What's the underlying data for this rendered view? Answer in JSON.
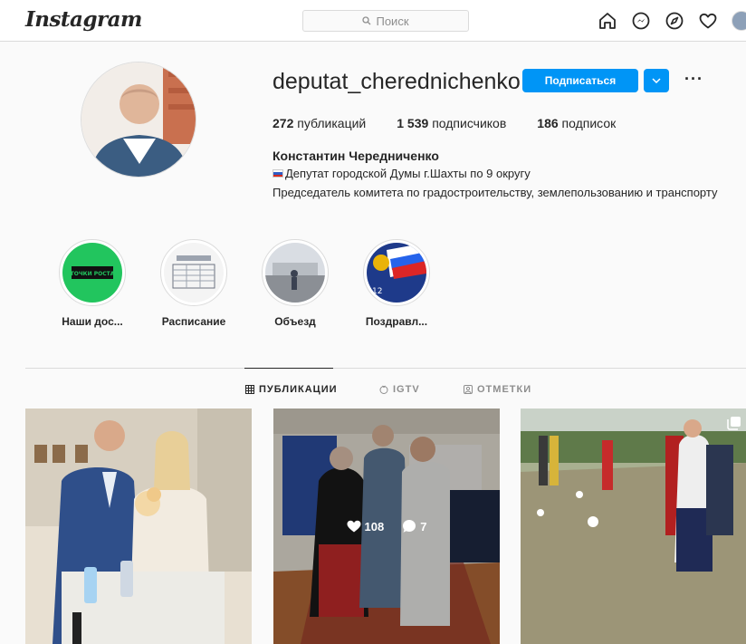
{
  "header": {
    "logo": "Instagram",
    "search_placeholder": "Поиск"
  },
  "profile": {
    "username": "deputat_cherednichenko",
    "follow_label": "Подписаться",
    "stats": [
      {
        "count": "272",
        "label": "публикаций"
      },
      {
        "count": "1 539",
        "label": "подписчиков"
      },
      {
        "count": "186",
        "label": "подписок"
      }
    ],
    "full_name": "Константин Чередниченко",
    "bio_line1": "Депутат городской Думы г.Шахты по 9 округу",
    "bio_line2": "Председатель комитета по градостроительству, землепользованию и транспорту"
  },
  "highlights": [
    {
      "label": "Наши дос...",
      "image_text": "ТОЧКИ РОСТА"
    },
    {
      "label": "Расписание"
    },
    {
      "label": "Объезд"
    },
    {
      "label": "Поздравл...",
      "image_text": "12"
    }
  ],
  "tabs": [
    {
      "label": "ПУБЛИКАЦИИ",
      "icon": "grid-icon",
      "active": true
    },
    {
      "label": "IGTV",
      "icon": "igtv-icon",
      "active": false
    },
    {
      "label": "ОТМЕТКИ",
      "icon": "tagged-icon",
      "active": false
    }
  ],
  "posts": [
    {
      "likes": "",
      "comments": ""
    },
    {
      "likes": "108",
      "comments": "7"
    },
    {
      "likes": "",
      "comments": ""
    }
  ],
  "colors": {
    "accent": "#0095f6",
    "border": "#dbdbdb",
    "bg": "#fafafa"
  }
}
